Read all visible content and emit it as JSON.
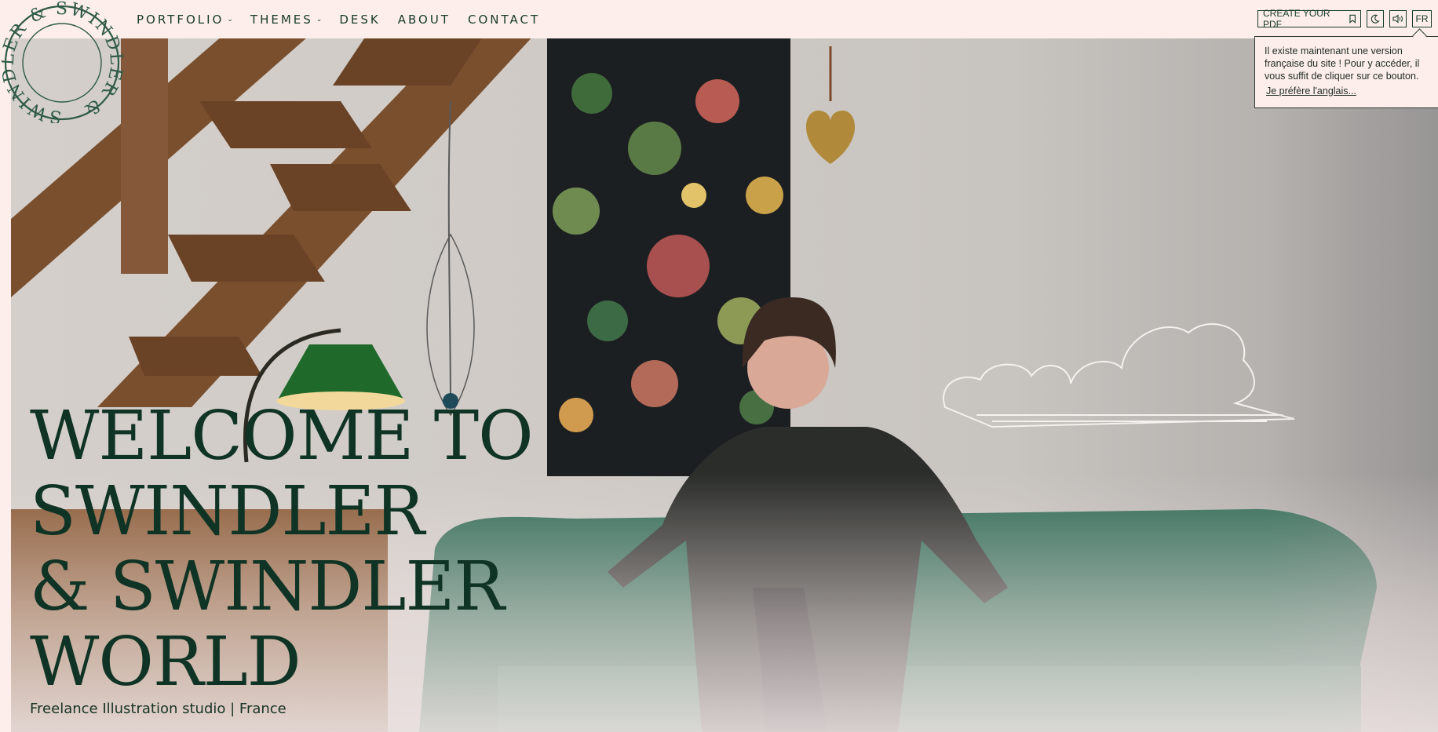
{
  "logo": {
    "text": "SWINDLER & SWINDLER",
    "color": "#2f5a47"
  },
  "nav": {
    "items": [
      {
        "label": "PORTFOLIO",
        "has_dropdown": true,
        "icon": "chevron-down-icon"
      },
      {
        "label": "THEMES",
        "has_dropdown": true,
        "icon": "chevron-down-icon"
      },
      {
        "label": "DESK",
        "has_dropdown": false
      },
      {
        "label": "ABOUT",
        "has_dropdown": false
      },
      {
        "label": "CONTACT",
        "has_dropdown": false
      }
    ]
  },
  "tools": {
    "pdf_label": "CREATE YOUR PDF",
    "pdf_icon": "bookmark-icon",
    "theme_icon": "moon-icon",
    "sound_icon": "speaker-icon",
    "lang_label": "FR"
  },
  "tooltip": {
    "message": "Il existe maintenant une version française du site ! Pour y accéder, il vous suffit de cliquer sur ce bouton.",
    "link": "Je préfère l'anglais..."
  },
  "hero": {
    "headline": [
      "WELCOME TO",
      "SWINDLER",
      "& SWINDLER",
      "WORLD"
    ],
    "tagline": "Freelance Illustration studio | France"
  },
  "colors": {
    "background": "#fdeeeb",
    "text": "#163a2a",
    "headline": "#0f3324",
    "sofa": "#2f6a55"
  }
}
